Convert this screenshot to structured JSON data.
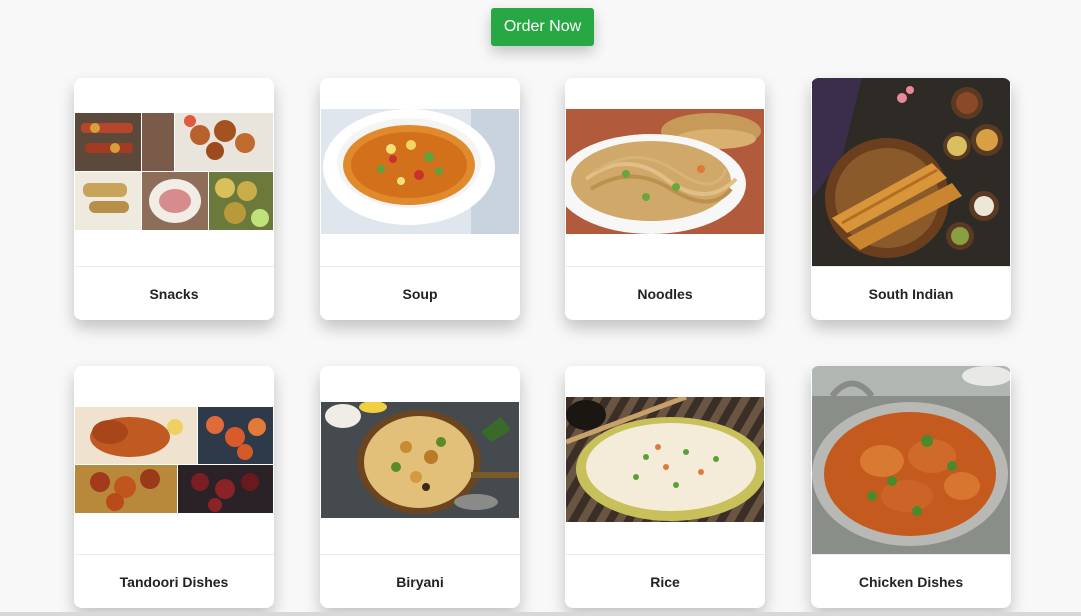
{
  "order_button": {
    "label": "Order Now"
  },
  "categories": [
    {
      "label": "Snacks"
    },
    {
      "label": "Soup"
    },
    {
      "label": "Noodles"
    },
    {
      "label": "South Indian"
    },
    {
      "label": "Tandoori Dishes"
    },
    {
      "label": "Biryani"
    },
    {
      "label": "Rice"
    },
    {
      "label": "Chicken Dishes"
    }
  ],
  "colors": {
    "accent": "#28a745"
  }
}
